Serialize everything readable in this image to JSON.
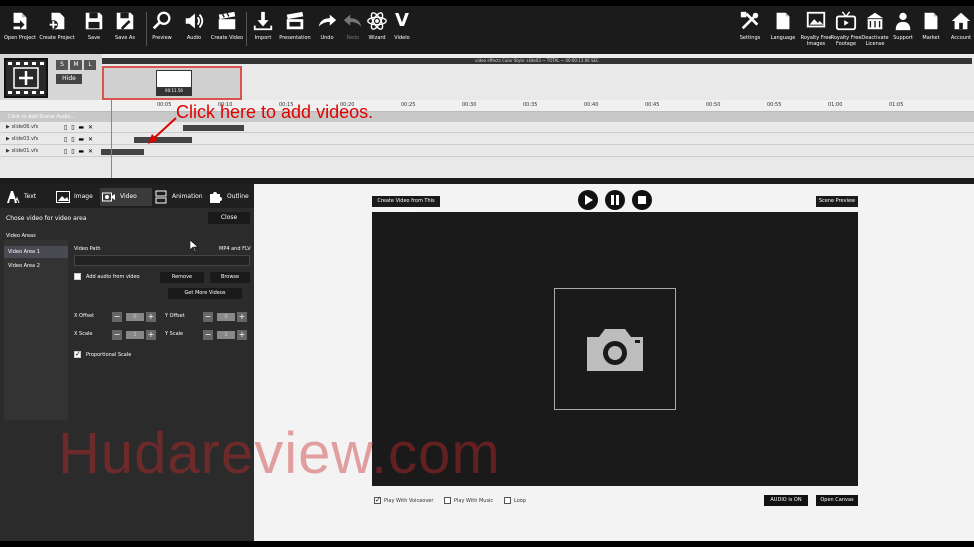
{
  "toolbar": {
    "left": [
      {
        "name": "open-project",
        "label": "Open Project"
      },
      {
        "name": "create-project",
        "label": "Create Project"
      },
      {
        "name": "save",
        "label": "Save"
      },
      {
        "name": "save-as",
        "label": "Save As"
      },
      {
        "name": "preview",
        "label": "Preview"
      },
      {
        "name": "audio",
        "label": "Audio"
      },
      {
        "name": "create-video",
        "label": "Create Video"
      },
      {
        "name": "import",
        "label": "Import"
      },
      {
        "name": "presentation",
        "label": "Presentation"
      },
      {
        "name": "undo",
        "label": "Undo"
      },
      {
        "name": "redo",
        "label": "Redo"
      },
      {
        "name": "wizard",
        "label": "Wizard"
      },
      {
        "name": "videlo",
        "label": "Videlo"
      }
    ],
    "right": [
      {
        "name": "settings",
        "label": "Settings"
      },
      {
        "name": "language",
        "label": "Language"
      },
      {
        "name": "royalty-free-images",
        "label": "Royalty Free Images"
      },
      {
        "name": "royalty-free-footage",
        "label": "Royalty Free Footage"
      },
      {
        "name": "deactivate-license",
        "label": "Deactivate License"
      },
      {
        "name": "support",
        "label": "Support"
      },
      {
        "name": "market",
        "label": "Market"
      },
      {
        "name": "account",
        "label": "Account"
      }
    ],
    "videlo_glyph": "V"
  },
  "timeline": {
    "size_buttons": [
      "S",
      "M",
      "L"
    ],
    "hide_label": "Hide",
    "header_text": "video effects Color Style: slide03 ~ TOTAL ~ 00:00:13.06 SEC",
    "clip_time": "00:11.56",
    "ticks": [
      "00:05",
      "00:10",
      "00:15",
      "00:20",
      "00:25",
      "00:30",
      "00:35",
      "00:40",
      "00:45",
      "00:50",
      "00:55",
      "01:00",
      "01:05"
    ],
    "scene_header": "Click to Add Scene Audio...",
    "tracks": [
      {
        "name": "slide06.vfs",
        "bar_start": 0.188,
        "bar_len": 0.063
      },
      {
        "name": "slide03.vfs",
        "bar_start": 0.138,
        "bar_len": 0.059
      },
      {
        "name": "slide01.vfs",
        "bar_start": 0.104,
        "bar_len": 0.044
      }
    ],
    "track_controls": "▯ ▯ ▬ ✕"
  },
  "annotation": {
    "text": "Click here to add videos.",
    "color": "#e00000"
  },
  "panel": {
    "tabs": [
      {
        "name": "text",
        "label": "Text"
      },
      {
        "name": "image",
        "label": "Image"
      },
      {
        "name": "video",
        "label": "Video"
      },
      {
        "name": "animation",
        "label": "Animation"
      },
      {
        "name": "outline",
        "label": "Outline"
      }
    ],
    "title": "Chose video for video area",
    "close_label": "Close",
    "areas_label": "Video Areas",
    "areas": [
      "Video Area 1",
      "Video Area 2"
    ],
    "video_path_label": "Video Path",
    "format_label": "MP4 and FLV",
    "video_path_value": "",
    "add_audio_label": "Add audio from video",
    "remove_label": "Remove",
    "browse_label": "Browse",
    "get_more_label": "Get More Videos",
    "x_offset_label": "X Offset",
    "y_offset_label": "Y Offset",
    "x_scale_label": "X Scale",
    "y_scale_label": "Y Scale",
    "x_offset": "0",
    "y_offset": "0",
    "x_scale": "1",
    "y_scale": "1",
    "proportional_label": "Proportional Scale",
    "proportional_checked": true
  },
  "preview": {
    "create_from_scene_label": "Create Video from This Scene",
    "scene_preview_label": "Scene Preview",
    "play_with_voiceover_label": "Play With Voiceover",
    "play_with_music_label": "Play With Music",
    "loop_label": "Loop",
    "audio_label": "AUDIO is ON",
    "open_canvas_label": "Open Canvas"
  },
  "watermark": "Hudareview.com"
}
